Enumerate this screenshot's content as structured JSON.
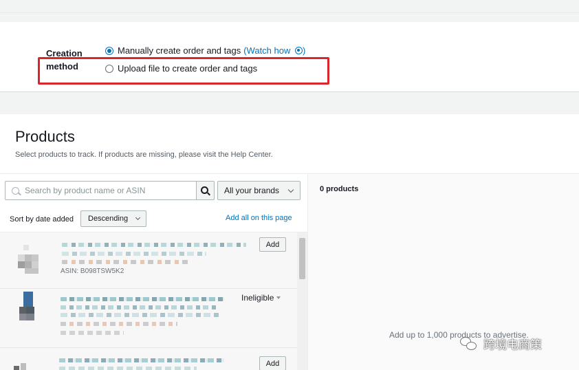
{
  "creation_method": {
    "label": "Creation method",
    "options": [
      {
        "label": "Manually create order and tags",
        "selected": true
      },
      {
        "label": "Upload file to create order and tags",
        "selected": false
      }
    ],
    "watch_link": "(Watch how",
    "watch_link_end": ")"
  },
  "products": {
    "title": "Products",
    "subtitle": "Select products to track. If products are missing, please visit the Help Center.",
    "search": {
      "placeholder": "Search by product name or ASIN"
    },
    "brand_filter": "All your brands",
    "sort": {
      "label": "Sort by date added",
      "value": "Descending"
    },
    "add_all_label": "Add all on this page",
    "rows": [
      {
        "action": "Add",
        "asin": "ASIN: B098TSW5K2"
      },
      {
        "action": "Ineligible"
      },
      {
        "action": "Add"
      }
    ]
  },
  "selected": {
    "count_label": "0 products",
    "note": "Add up to 1,000 products to advertise."
  },
  "watermark": {
    "text": "跨境电商策"
  },
  "colors": {
    "accent": "#0073bb",
    "highlight": "#d9262c"
  }
}
